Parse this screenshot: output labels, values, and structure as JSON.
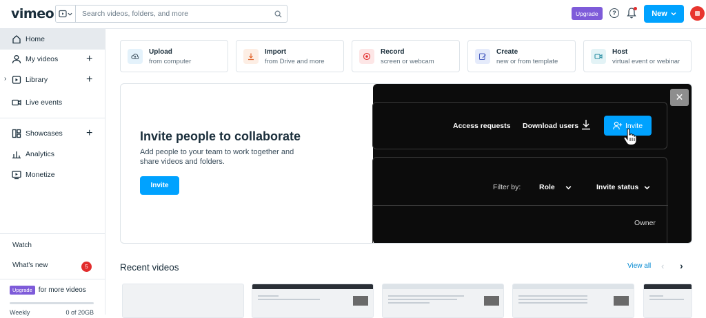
{
  "header": {
    "logo": "vimeo",
    "search_placeholder": "Search videos, folders, and more",
    "upgrade_label": "Upgrade",
    "help_label": "?",
    "new_label": "New"
  },
  "sidebar": {
    "items": [
      {
        "label": "Home"
      },
      {
        "label": "My videos"
      },
      {
        "label": "Library"
      },
      {
        "label": "Live events"
      },
      {
        "label": "Showcases"
      },
      {
        "label": "Analytics"
      },
      {
        "label": "Monetize"
      }
    ],
    "watch_label": "Watch",
    "whats_new_label": "What's new",
    "whats_new_count": "5",
    "upgrade_pill": "Upgrade",
    "upgrade_text": "for more videos",
    "storage_label": "Weekly",
    "storage_value": "0 of 20GB",
    "storage_fraction": 0
  },
  "actions": [
    {
      "title": "Upload",
      "subtitle": "from computer",
      "color": "#e4f2fb",
      "icon": "upload-icon"
    },
    {
      "title": "Import",
      "subtitle": "from Drive and more",
      "color": "#fdeee4",
      "icon": "import-icon"
    },
    {
      "title": "Record",
      "subtitle": "screen or webcam",
      "color": "#fde6e6",
      "icon": "record-icon"
    },
    {
      "title": "Create",
      "subtitle": "new or from template",
      "color": "#e5ebfb",
      "icon": "create-icon"
    },
    {
      "title": "Host",
      "subtitle": "virtual event or webinar",
      "color": "#e3f3f6",
      "icon": "host-icon"
    }
  ],
  "promo": {
    "title": "Invite people to collaborate",
    "description": "Add people to your team to work together and share videos and folders.",
    "invite_label": "Invite",
    "preview": {
      "access_requests": "Access requests",
      "download_users": "Download users",
      "invite_label": "Invite",
      "filter_by": "Filter by:",
      "role": "Role",
      "invite_status": "Invite status",
      "owner": "Owner"
    }
  },
  "recent": {
    "title": "Recent videos",
    "view_all": "View all"
  }
}
